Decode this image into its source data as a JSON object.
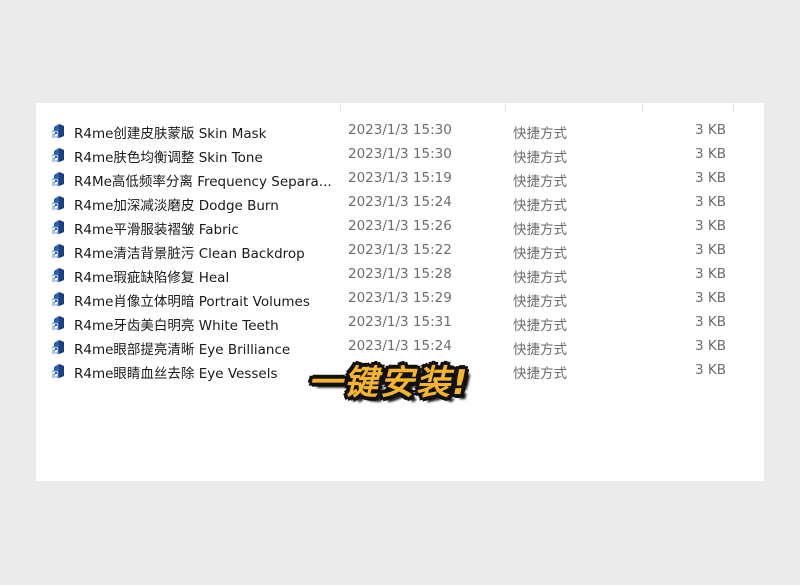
{
  "files": [
    {
      "name": "R4me创建皮肤蒙版 Skin Mask",
      "date": "2023/1/3 15:30",
      "type": "快捷方式",
      "size": "3 KB"
    },
    {
      "name": "R4me肤色均衡调整 Skin Tone",
      "date": "2023/1/3 15:30",
      "type": "快捷方式",
      "size": "3 KB"
    },
    {
      "name": "R4Me高低频率分离 Frequency Separa...",
      "date": "2023/1/3 15:19",
      "type": "快捷方式",
      "size": "3 KB"
    },
    {
      "name": "R4me加深减淡磨皮 Dodge Burn",
      "date": "2023/1/3 15:24",
      "type": "快捷方式",
      "size": "3 KB"
    },
    {
      "name": "R4me平滑服装褶皱 Fabric",
      "date": "2023/1/3 15:26",
      "type": "快捷方式",
      "size": "3 KB"
    },
    {
      "name": "R4me清洁背景脏污 Clean Backdrop",
      "date": "2023/1/3 15:22",
      "type": "快捷方式",
      "size": "3 KB"
    },
    {
      "name": "R4me瑕疵缺陷修复 Heal",
      "date": "2023/1/3 15:28",
      "type": "快捷方式",
      "size": "3 KB"
    },
    {
      "name": "R4me肖像立体明暗 Portrait Volumes",
      "date": "2023/1/3 15:29",
      "type": "快捷方式",
      "size": "3 KB"
    },
    {
      "name": "R4me牙齿美白明亮 White Teeth",
      "date": "2023/1/3 15:31",
      "type": "快捷方式",
      "size": "3 KB"
    },
    {
      "name": "R4me眼部提亮清晰 Eye Brilliance",
      "date": "2023/1/3 15:24",
      "type": "快捷方式",
      "size": "3 KB"
    },
    {
      "name": "R4me眼睛血丝去除 Eye Vessels",
      "date": "",
      "type": "快捷方式",
      "size": "3 KB"
    }
  ],
  "overlay": {
    "text": "一键安装!"
  },
  "icons": {
    "file": "shortcut-icon"
  }
}
